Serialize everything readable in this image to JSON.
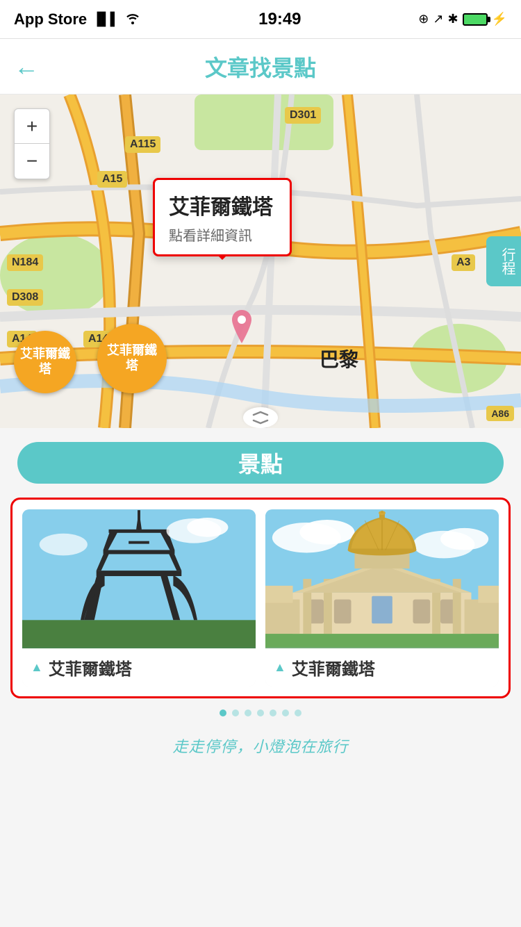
{
  "statusBar": {
    "carrier": "App Store",
    "signalBars": "●●●●",
    "wifi": "wifi",
    "time": "19:49",
    "battery": "full"
  },
  "navBar": {
    "backLabel": "←",
    "title": "文章找景點"
  },
  "map": {
    "zoomIn": "+",
    "zoomOut": "−",
    "routeBtn": "行程",
    "popup": {
      "title": "艾菲爾鐵塔",
      "subtitle": "點看詳細資訊"
    },
    "clusters": [
      {
        "label": "艾菲爾鐵\n塔"
      },
      {
        "label": "艾菲爾鐵\n塔"
      }
    ],
    "roadLabels": [
      "D301",
      "A115",
      "A15",
      "N184",
      "D308",
      "A14",
      "A14",
      "A3"
    ],
    "cityLabel": "巴黎",
    "expandToggle": "⌃⌄"
  },
  "section": {
    "label": "景點"
  },
  "cards": [
    {
      "title": "艾菲爾鐵塔",
      "iconLabel": "▲"
    },
    {
      "title": "艾菲爾鐵塔",
      "iconLabel": "▲"
    }
  ],
  "footer": {
    "watermark": "走走停停，小燈泡在旅行"
  }
}
